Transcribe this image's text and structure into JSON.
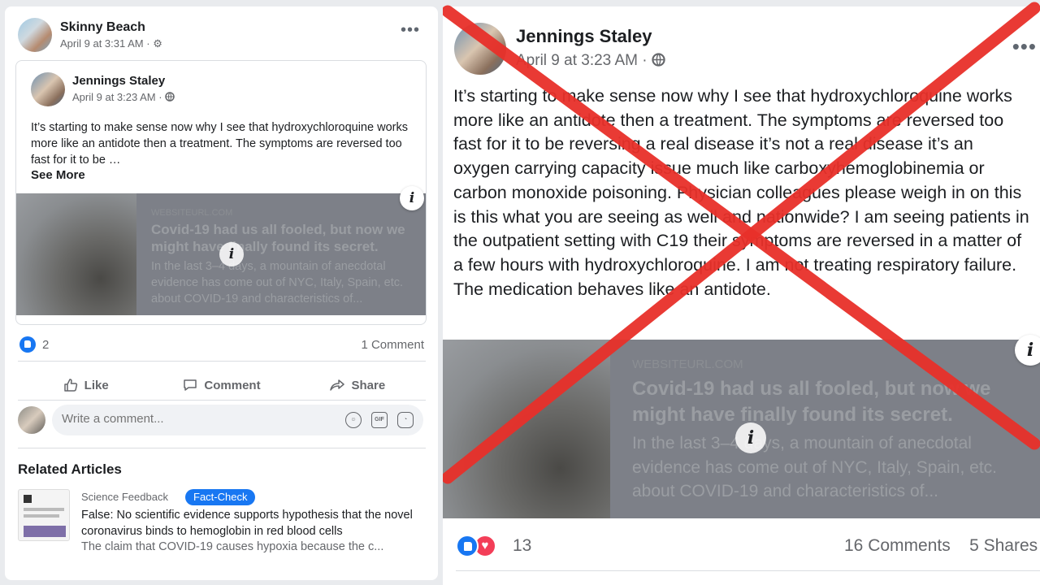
{
  "left_post": {
    "author": "Skinny Beach",
    "timestamp": "April 9 at 3:31 AM",
    "visibility_icon": "gear-icon",
    "more_label": "•••",
    "shared": {
      "author": "Jennings Staley",
      "timestamp": "April 9 at 3:23 AM",
      "visibility_icon": "globe-icon",
      "text": "It’s starting to make sense now why I see that hydroxychloroquine works more like an antidote then a treatment. The symptoms are reversed too fast for it to be …",
      "see_more": "See More"
    },
    "link_preview": {
      "domain": "WEBSITEURL.COM",
      "title": "Covid-19 had us all fooled, but now we might have finally found its secret.",
      "description": "In the last 3–4 days, a mountain of anecdotal evidence has come out of NYC, Italy, Spain, etc. about COVID-19 and characteristics of...",
      "info": "i"
    },
    "reaction_count": "2",
    "comment_count": "1 Comment",
    "actions": {
      "like": "Like",
      "comment": "Comment",
      "share": "Share"
    },
    "comment_placeholder": "Write a comment...",
    "related_title": "Related Articles",
    "related": {
      "source": "Science Feedback",
      "badge": "Fact-Check",
      "headline": "False: No scientific evidence supports hypothesis that the novel coronavirus binds to hemoglobin in red blood cells",
      "snippet": "The claim that COVID-19 causes hypoxia because the c..."
    }
  },
  "right_post": {
    "author": "Jennings Staley",
    "timestamp": "April 9 at 3:23 AM",
    "more_label": "•••",
    "text": "It’s starting to make sense now why I see that hydroxychloroquine works more like an antidote then a treatment. The symptoms are reversed too fast for it to be reversing a real disease it’s not a real disease it’s an oxygen carrying capacity issue much like carboxyhemoglobinemia or carbon monoxide poisoning. Physician colleagues please weigh in on this is this what you are seeing as well and nationwide? I am seeing patients in the outpatient setting with C19 their symptoms are reversed in a matter of a few hours with hydroxychloroquine. I am not treating respiratory failure. The medication behaves like an antidote.",
    "link_preview": {
      "domain": "WEBSITEURL.COM",
      "title": "Covid-19 had us all fooled, but now we might have finally found its secret.",
      "description": "In the last 3–4 days, a mountain of anecdotal evidence has come out of NYC, Italy, Spain, etc. about COVID-19 and characteristics of...",
      "info": "i"
    },
    "reaction_count": "13",
    "comments": "16 Comments",
    "shares": "5 Shares"
  },
  "overlay": {
    "mark": "red-x",
    "color": "#e8302a"
  },
  "colors": {
    "accent": "#1877f2",
    "love": "#f33e58",
    "muted": "#65676b"
  }
}
